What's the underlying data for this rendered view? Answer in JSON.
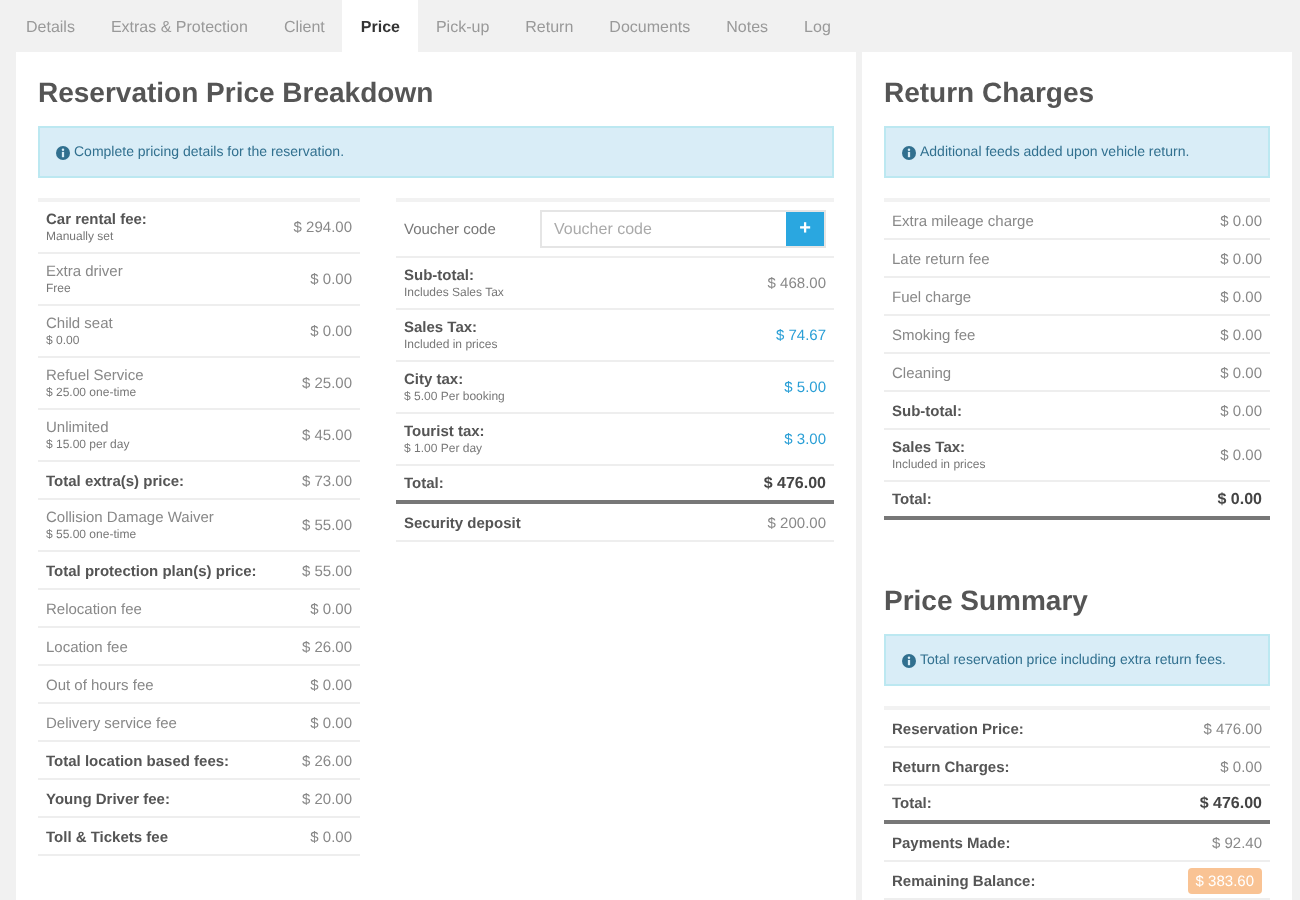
{
  "tabs": [
    {
      "label": "Details",
      "selected": false
    },
    {
      "label": "Extras & Protection",
      "selected": false
    },
    {
      "label": "Client",
      "selected": false
    },
    {
      "label": "Price",
      "selected": true
    },
    {
      "label": "Pick-up",
      "selected": false
    },
    {
      "label": "Return",
      "selected": false
    },
    {
      "label": "Documents",
      "selected": false
    },
    {
      "label": "Notes",
      "selected": false
    },
    {
      "label": "Log",
      "selected": false
    }
  ],
  "breakdown": {
    "title": "Reservation Price Breakdown",
    "info": "Complete pricing details for the reservation.",
    "rows": [
      {
        "kind": "total",
        "label": "Car rental fee:",
        "note": "Manually set",
        "value": "$ 294.00"
      },
      {
        "kind": "item",
        "label": "Extra driver",
        "note": "Free",
        "value": "$ 0.00"
      },
      {
        "kind": "item",
        "label": "Child seat",
        "note": "$ 0.00",
        "value": "$ 0.00"
      },
      {
        "kind": "item",
        "label": "Refuel Service",
        "note": "$ 25.00 one-time",
        "value": "$ 25.00"
      },
      {
        "kind": "item",
        "label": "Unlimited",
        "note": "$ 15.00 per day",
        "value": "$ 45.00"
      },
      {
        "kind": "total",
        "label": "Total extra(s) price:",
        "value": "$ 73.00"
      },
      {
        "kind": "item",
        "label": "Collision Damage Waiver",
        "note": "$ 55.00 one-time",
        "value": "$ 55.00"
      },
      {
        "kind": "total",
        "label": "Total protection plan(s) price:",
        "value": "$ 55.00"
      },
      {
        "kind": "item",
        "label": "Relocation fee",
        "value": "$ 0.00"
      },
      {
        "kind": "item",
        "label": "Location fee",
        "value": "$ 26.00"
      },
      {
        "kind": "item",
        "label": "Out of hours fee",
        "value": "$ 0.00"
      },
      {
        "kind": "item",
        "label": "Delivery service fee",
        "value": "$ 0.00"
      },
      {
        "kind": "total",
        "label": "Total location based fees:",
        "value": "$ 26.00"
      },
      {
        "kind": "total",
        "label": "Young Driver fee:",
        "value": "$ 20.00"
      },
      {
        "kind": "total",
        "label": "Toll & Tickets fee",
        "value": "$ 0.00"
      }
    ],
    "voucher": {
      "label": "Voucher code",
      "placeholder": "Voucher code",
      "button": "+"
    },
    "summary_rows": [
      {
        "kind": "total",
        "label": "Sub-total:",
        "note": "Includes Sales Tax",
        "value": "$ 468.00"
      },
      {
        "kind": "tax",
        "label": "Sales Tax:",
        "note": "Included in prices",
        "value": "$ 74.67"
      },
      {
        "kind": "tax",
        "label": "City tax:",
        "note": "$ 5.00 Per booking",
        "value": "$ 5.00"
      },
      {
        "kind": "tax",
        "label": "Tourist tax:",
        "note": "$ 1.00 Per day",
        "value": "$ 3.00"
      },
      {
        "kind": "grand",
        "label": "Total:",
        "value": "$ 476.00"
      },
      {
        "kind": "total",
        "label": "Security deposit",
        "value": "$ 200.00"
      }
    ]
  },
  "return_charges": {
    "title": "Return Charges",
    "info": "Additional feeds added upon vehicle return.",
    "rows": [
      {
        "kind": "item",
        "label": "Extra mileage charge",
        "value": "$ 0.00"
      },
      {
        "kind": "item",
        "label": "Late return fee",
        "value": "$ 0.00"
      },
      {
        "kind": "item",
        "label": "Fuel charge",
        "value": "$ 0.00"
      },
      {
        "kind": "item",
        "label": "Smoking fee",
        "value": "$ 0.00"
      },
      {
        "kind": "item",
        "label": "Cleaning",
        "value": "$ 0.00"
      },
      {
        "kind": "total",
        "label": "Sub-total:",
        "value": "$ 0.00"
      },
      {
        "kind": "total",
        "label": "Sales Tax:",
        "note": "Included in prices",
        "value": "$ 0.00"
      },
      {
        "kind": "grand",
        "label": "Total:",
        "value": "$ 0.00"
      }
    ]
  },
  "price_summary": {
    "title": "Price Summary",
    "info": "Total reservation price including extra return fees.",
    "rows": [
      {
        "kind": "total",
        "label": "Reservation Price:",
        "value": "$ 476.00"
      },
      {
        "kind": "total",
        "label": "Return Charges:",
        "value": "$ 0.00"
      },
      {
        "kind": "grand",
        "label": "Total:",
        "value": "$ 476.00"
      },
      {
        "kind": "total",
        "label": "Payments Made:",
        "value": "$ 92.40"
      },
      {
        "kind": "balance",
        "label": "Remaining Balance:",
        "value": "$ 383.60"
      }
    ]
  }
}
